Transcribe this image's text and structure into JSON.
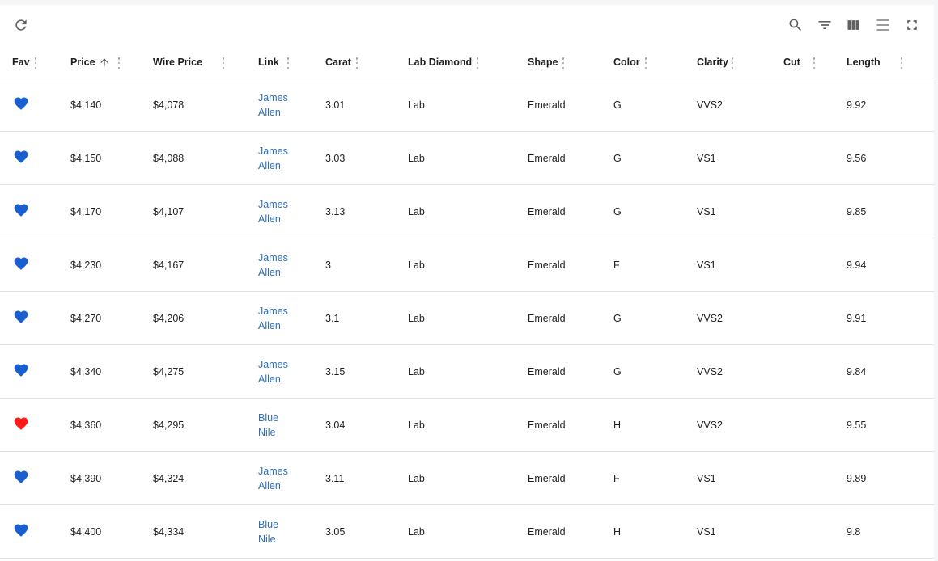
{
  "toolbar": {
    "icons": [
      "refresh-icon",
      "search-icon",
      "filter-icon",
      "columns-icon",
      "density-icon",
      "fullscreen-icon"
    ]
  },
  "colors": {
    "favorite_blue": "#1a5fd0",
    "favorite_red": "#ff1a1a",
    "link": "#2f6fb8"
  },
  "columns": [
    "Fav",
    "Price",
    "Wire Price",
    "Link",
    "Carat",
    "Lab Diamond",
    "Shape",
    "Color",
    "Clarity",
    "Cut",
    "Length"
  ],
  "sort": {
    "column": "Price",
    "direction": "ascending"
  },
  "rows": [
    {
      "fav": "blue",
      "price": "$4,140",
      "wire_price": "$4,078",
      "link": "James Allen",
      "carat": "3.01",
      "lab": "Lab",
      "shape": "Emerald",
      "color": "G",
      "clarity": "VVS2",
      "cut": "",
      "length": "9.92"
    },
    {
      "fav": "blue",
      "price": "$4,150",
      "wire_price": "$4,088",
      "link": "James Allen",
      "carat": "3.03",
      "lab": "Lab",
      "shape": "Emerald",
      "color": "G",
      "clarity": "VS1",
      "cut": "",
      "length": "9.56"
    },
    {
      "fav": "blue",
      "price": "$4,170",
      "wire_price": "$4,107",
      "link": "James Allen",
      "carat": "3.13",
      "lab": "Lab",
      "shape": "Emerald",
      "color": "G",
      "clarity": "VS1",
      "cut": "",
      "length": "9.85"
    },
    {
      "fav": "blue",
      "price": "$4,230",
      "wire_price": "$4,167",
      "link": "James Allen",
      "carat": "3",
      "lab": "Lab",
      "shape": "Emerald",
      "color": "F",
      "clarity": "VS1",
      "cut": "",
      "length": "9.94"
    },
    {
      "fav": "blue",
      "price": "$4,270",
      "wire_price": "$4,206",
      "link": "James Allen",
      "carat": "3.1",
      "lab": "Lab",
      "shape": "Emerald",
      "color": "G",
      "clarity": "VVS2",
      "cut": "",
      "length": "9.91"
    },
    {
      "fav": "blue",
      "price": "$4,340",
      "wire_price": "$4,275",
      "link": "James Allen",
      "carat": "3.15",
      "lab": "Lab",
      "shape": "Emerald",
      "color": "G",
      "clarity": "VVS2",
      "cut": "",
      "length": "9.84"
    },
    {
      "fav": "red",
      "price": "$4,360",
      "wire_price": "$4,295",
      "link": "Blue Nile",
      "carat": "3.04",
      "lab": "Lab",
      "shape": "Emerald",
      "color": "H",
      "clarity": "VVS2",
      "cut": "",
      "length": "9.55"
    },
    {
      "fav": "blue",
      "price": "$4,390",
      "wire_price": "$4,324",
      "link": "James Allen",
      "carat": "3.11",
      "lab": "Lab",
      "shape": "Emerald",
      "color": "F",
      "clarity": "VS1",
      "cut": "",
      "length": "9.89"
    },
    {
      "fav": "blue",
      "price": "$4,400",
      "wire_price": "$4,334",
      "link": "Blue Nile",
      "carat": "3.05",
      "lab": "Lab",
      "shape": "Emerald",
      "color": "H",
      "clarity": "VS1",
      "cut": "",
      "length": "9.8"
    }
  ]
}
